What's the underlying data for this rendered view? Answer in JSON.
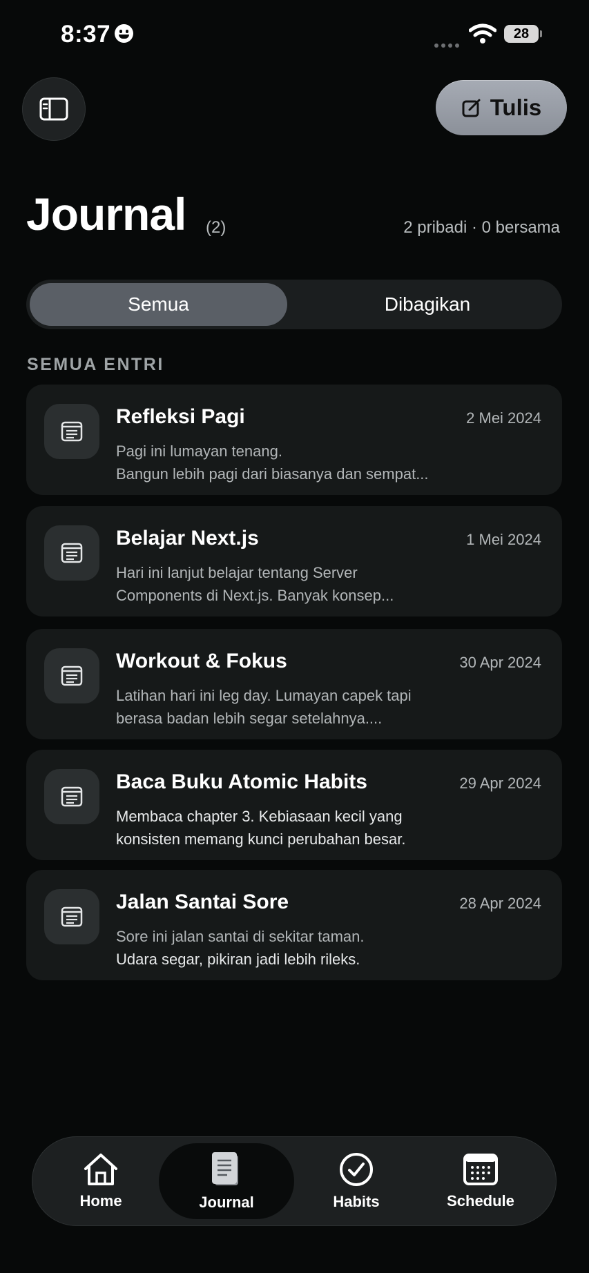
{
  "status_bar": {
    "time": "8:37",
    "battery": "28"
  },
  "header": {
    "write_button_label": "Tulis"
  },
  "page": {
    "title": "Journal",
    "count": "(2)",
    "summary": "2 pribadi · 0 bersama"
  },
  "segments": {
    "all": "Semua",
    "shared": "Dibagikan",
    "active": "Semua"
  },
  "section_label": "SEMUA ENTRI",
  "entries": [
    {
      "title": "Refleksi Pagi",
      "date": "2 Mei 2024",
      "line1": "Pagi ini lumayan tenang.",
      "line2": "Bangun lebih pagi dari biasanya dan sempat..."
    },
    {
      "title": "Belajar Next.js",
      "date": "1 Mei 2024",
      "line1": "Hari ini lanjut belajar tentang Server",
      "line2": "Components di Next.js. Banyak konsep..."
    },
    {
      "title": "Workout & Fokus",
      "date": "30 Apr 2024",
      "line1": "Latihan hari ini leg day. Lumayan capek tapi",
      "line2": "berasa badan lebih segar setelahnya...."
    },
    {
      "title": "Baca Buku Atomic Habits",
      "date": "29 Apr 2024",
      "line1": "Membaca chapter 3. Kebiasaan kecil yang",
      "line2": "konsisten memang kunci perubahan besar."
    },
    {
      "title": "Jalan Santai Sore",
      "date": "28 Apr 2024",
      "line1": "Sore ini jalan santai di sekitar taman.",
      "line2": "Udara segar, pikiran jadi lebih rileks."
    }
  ],
  "nav": {
    "active": "Journal",
    "items": [
      {
        "label": "Home",
        "icon": "home-icon"
      },
      {
        "label": "Journal",
        "icon": "journal-icon"
      },
      {
        "label": "Habits",
        "icon": "check-circle-icon"
      },
      {
        "label": "Schedule",
        "icon": "calendar-icon"
      }
    ]
  },
  "colors": {
    "background": "#070909",
    "card": "#161919",
    "accent_button": "#9ca1aa",
    "segment_active": "#5a5f66"
  }
}
